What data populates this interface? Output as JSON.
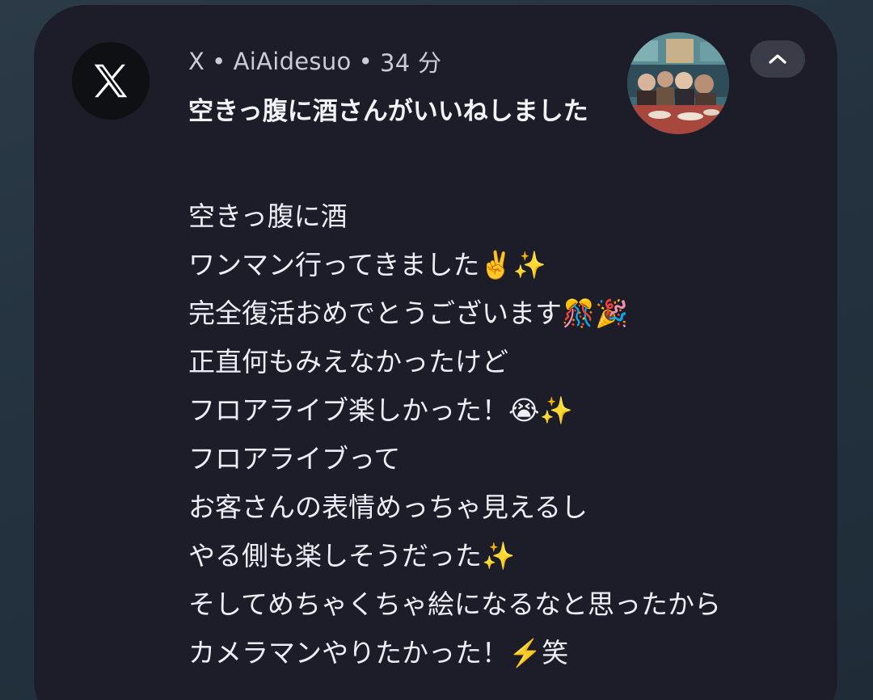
{
  "notification": {
    "app_name": "X",
    "separator": "•",
    "account": "AiAidesuo",
    "time": "34 分",
    "app_icon": "x-logo-icon",
    "avatar": "group-photo-avatar",
    "collapse_icon": "chevron-up-icon",
    "title": "空きっ腹に酒さんがいいねしました",
    "body_lines": [
      "空きっ腹に酒",
      "ワンマン行ってきました✌️✨",
      "完全復活おめでとうございます🎊🎉",
      "正直何もみえなかったけど",
      "フロアライブ楽しかった！😭✨",
      "フロアライブって",
      "お客さんの表情めっちゃ見えるし",
      "やる側も楽しそうだった✨",
      "そしてめちゃくちゃ絵になるなと思ったから",
      "カメラマンやりたかった！⚡️笑"
    ]
  },
  "colors": {
    "card_background": "#1c1d28",
    "page_background": "#243240",
    "text_primary": "#eceef5",
    "text_secondary": "#c9cbd6",
    "button_background": "#3a3c47"
  }
}
